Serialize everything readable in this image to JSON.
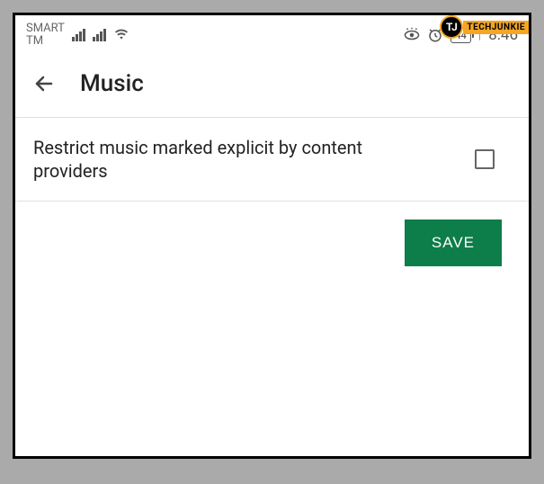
{
  "watermark": {
    "logo": "TJ",
    "text": "TECHJUNKIE"
  },
  "statusBar": {
    "carrier": "SMART\nTM",
    "battery": "44",
    "clock": "8:46"
  },
  "header": {
    "title": "Music"
  },
  "setting": {
    "label": "Restrict music marked explicit by content providers"
  },
  "actions": {
    "save": "SAVE"
  }
}
